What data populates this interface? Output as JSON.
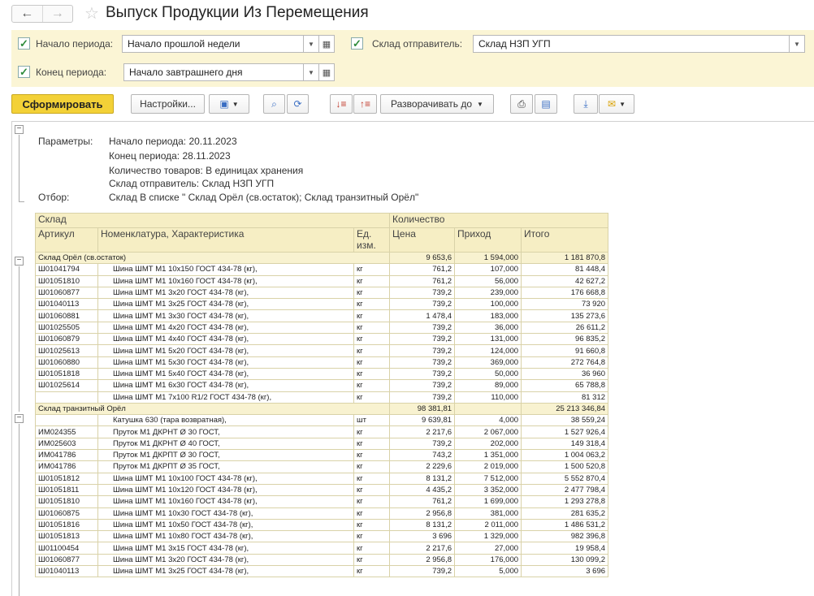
{
  "header": {
    "title": "Выпуск Продукции Из Перемещения",
    "back_icon": "←",
    "forward_icon": "→"
  },
  "filters": {
    "start_label": "Начало периода:",
    "start_value": "Начало прошлой недели",
    "end_label": "Конец периода:",
    "end_value": "Начало завтрашнего дня",
    "warehouse_label": "Склад отправитель:",
    "warehouse_value": "Склад НЗП УГП"
  },
  "toolbar": {
    "generate_label": "Сформировать",
    "settings_label": "Настройки...",
    "expand_label": "Разворачивать до"
  },
  "parameters": {
    "params_label": "Параметры:",
    "filter_label": "Отбор:",
    "lines": [
      "Начало периода: 20.11.2023",
      "Конец периода: 28.11.2023",
      "Количество товаров: В единицах хранения",
      "Склад отправитель: Склад НЗП УГП"
    ],
    "filter_value": "Склад В списке \" Склад Орёл (св.остаток);  Склад транзитный Орёл\""
  },
  "table": {
    "header_top": [
      "Склад",
      "Количество"
    ],
    "header_cols": [
      "Артикул",
      "Номенклатура, Характеристика",
      "Ед. изм.",
      "Цена",
      "Приход",
      "Итого"
    ],
    "groups": [
      {
        "name": "Склад Орёл (св.остаток)",
        "price": "9 653,6",
        "income": "1 594,000",
        "total": "1 181 870,8",
        "rows": [
          {
            "art": "Ш01041794",
            "name": "Шина ШМТ М1 10х150 ГОСТ 434-78 (кг),",
            "unit": "кг",
            "price": "761,2",
            "income": "107,000",
            "total": "81 448,4"
          },
          {
            "art": "Ш01051810",
            "name": "Шина ШМТ М1 10х160 ГОСТ 434-78 (кг),",
            "unit": "кг",
            "price": "761,2",
            "income": "56,000",
            "total": "42 627,2"
          },
          {
            "art": "Ш01060877",
            "name": "Шина ШМТ М1 3х20 ГОСТ 434-78 (кг),",
            "unit": "кг",
            "price": "739,2",
            "income": "239,000",
            "total": "176 668,8"
          },
          {
            "art": "Ш01040113",
            "name": "Шина ШМТ М1 3х25 ГОСТ 434-78 (кг),",
            "unit": "кг",
            "price": "739,2",
            "income": "100,000",
            "total": "73 920"
          },
          {
            "art": "Ш01060881",
            "name": "Шина ШМТ М1 3х30 ГОСТ 434-78 (кг),",
            "unit": "кг",
            "price": "1 478,4",
            "income": "183,000",
            "total": "135 273,6"
          },
          {
            "art": "Ш01025505",
            "name": "Шина ШМТ М1 4х20 ГОСТ 434-78 (кг),",
            "unit": "кг",
            "price": "739,2",
            "income": "36,000",
            "total": "26 611,2"
          },
          {
            "art": "Ш01060879",
            "name": "Шина ШМТ М1 4х40 ГОСТ 434-78 (кг),",
            "unit": "кг",
            "price": "739,2",
            "income": "131,000",
            "total": "96 835,2"
          },
          {
            "art": "Ш01025613",
            "name": "Шина ШМТ М1 5х20 ГОСТ 434-78 (кг),",
            "unit": "кг",
            "price": "739,2",
            "income": "124,000",
            "total": "91 660,8"
          },
          {
            "art": "Ш01060880",
            "name": "Шина ШМТ М1 5х30 ГОСТ 434-78 (кг),",
            "unit": "кг",
            "price": "739,2",
            "income": "369,000",
            "total": "272 764,8"
          },
          {
            "art": "Ш01051818",
            "name": "Шина ШМТ М1 5х40 ГОСТ 434-78 (кг),",
            "unit": "кг",
            "price": "739,2",
            "income": "50,000",
            "total": "36 960"
          },
          {
            "art": "Ш01025614",
            "name": "Шина ШМТ М1 6х30 ГОСТ 434-78 (кг),",
            "unit": "кг",
            "price": "739,2",
            "income": "89,000",
            "total": "65 788,8"
          },
          {
            "art": "",
            "name": "Шина ШМТ М1 7х100 R1/2 ГОСТ 434-78 (кг),",
            "unit": "кг",
            "price": "739,2",
            "income": "110,000",
            "total": "81 312"
          }
        ]
      },
      {
        "name": "Склад транзитный Орёл",
        "price": "98 381,81",
        "income": "",
        "total": "25 213 346,84",
        "rows": [
          {
            "art": "",
            "name": "Катушка 630 (тара возвратная),",
            "unit": "шт",
            "price": "9 639,81",
            "income": "4,000",
            "total": "38 559,24"
          },
          {
            "art": "ИМ024355",
            "name": "Пруток М1 ДКРНТ Ø 30 ГОСТ,",
            "unit": "кг",
            "price": "2 217,6",
            "income": "2 067,000",
            "total": "1 527 926,4"
          },
          {
            "art": "ИМ025603",
            "name": "Пруток М1 ДКРНТ Ø 40 ГОСТ,",
            "unit": "кг",
            "price": "739,2",
            "income": "202,000",
            "total": "149 318,4"
          },
          {
            "art": "ИМ041786",
            "name": "Пруток М1 ДКРПТ Ø 30 ГОСТ,",
            "unit": "кг",
            "price": "743,2",
            "income": "1 351,000",
            "total": "1 004 063,2"
          },
          {
            "art": "ИМ041786",
            "name": "Пруток М1 ДКРПТ Ø 35 ГОСТ,",
            "unit": "кг",
            "price": "2 229,6",
            "income": "2 019,000",
            "total": "1 500 520,8"
          },
          {
            "art": "Ш01051812",
            "name": "Шина ШМТ М1 10х100 ГОСТ 434-78 (кг),",
            "unit": "кг",
            "price": "8 131,2",
            "income": "7 512,000",
            "total": "5 552 870,4"
          },
          {
            "art": "Ш01051811",
            "name": "Шина ШМТ М1 10х120 ГОСТ 434-78 (кг),",
            "unit": "кг",
            "price": "4 435,2",
            "income": "3 352,000",
            "total": "2 477 798,4"
          },
          {
            "art": "Ш01051810",
            "name": "Шина ШМТ М1 10х160 ГОСТ 434-78 (кг),",
            "unit": "кг",
            "price": "761,2",
            "income": "1 699,000",
            "total": "1 293 278,8"
          },
          {
            "art": "Ш01060875",
            "name": "Шина ШМТ М1 10х30 ГОСТ 434-78 (кг),",
            "unit": "кг",
            "price": "2 956,8",
            "income": "381,000",
            "total": "281 635,2"
          },
          {
            "art": "Ш01051816",
            "name": "Шина ШМТ М1 10х50 ГОСТ 434-78 (кг),",
            "unit": "кг",
            "price": "8 131,2",
            "income": "2 011,000",
            "total": "1 486 531,2"
          },
          {
            "art": "Ш01051813",
            "name": "Шина ШМТ М1 10х80 ГОСТ 434-78 (кг),",
            "unit": "кг",
            "price": "3 696",
            "income": "1 329,000",
            "total": "982 396,8"
          },
          {
            "art": "Ш01100454",
            "name": "Шина ШМТ М1 3х15 ГОСТ 434-78 (кг),",
            "unit": "кг",
            "price": "2 217,6",
            "income": "27,000",
            "total": "19 958,4"
          },
          {
            "art": "Ш01060877",
            "name": "Шина ШМТ М1 3х20 ГОСТ 434-78 (кг),",
            "unit": "кг",
            "price": "2 956,8",
            "income": "176,000",
            "total": "130 099,2"
          },
          {
            "art": "Ш01040113",
            "name": "Шина ШМТ М1 3х25 ГОСТ 434-78 (кг),",
            "unit": "кг",
            "price": "739,2",
            "income": "5,000",
            "total": "3 696"
          }
        ]
      }
    ]
  }
}
